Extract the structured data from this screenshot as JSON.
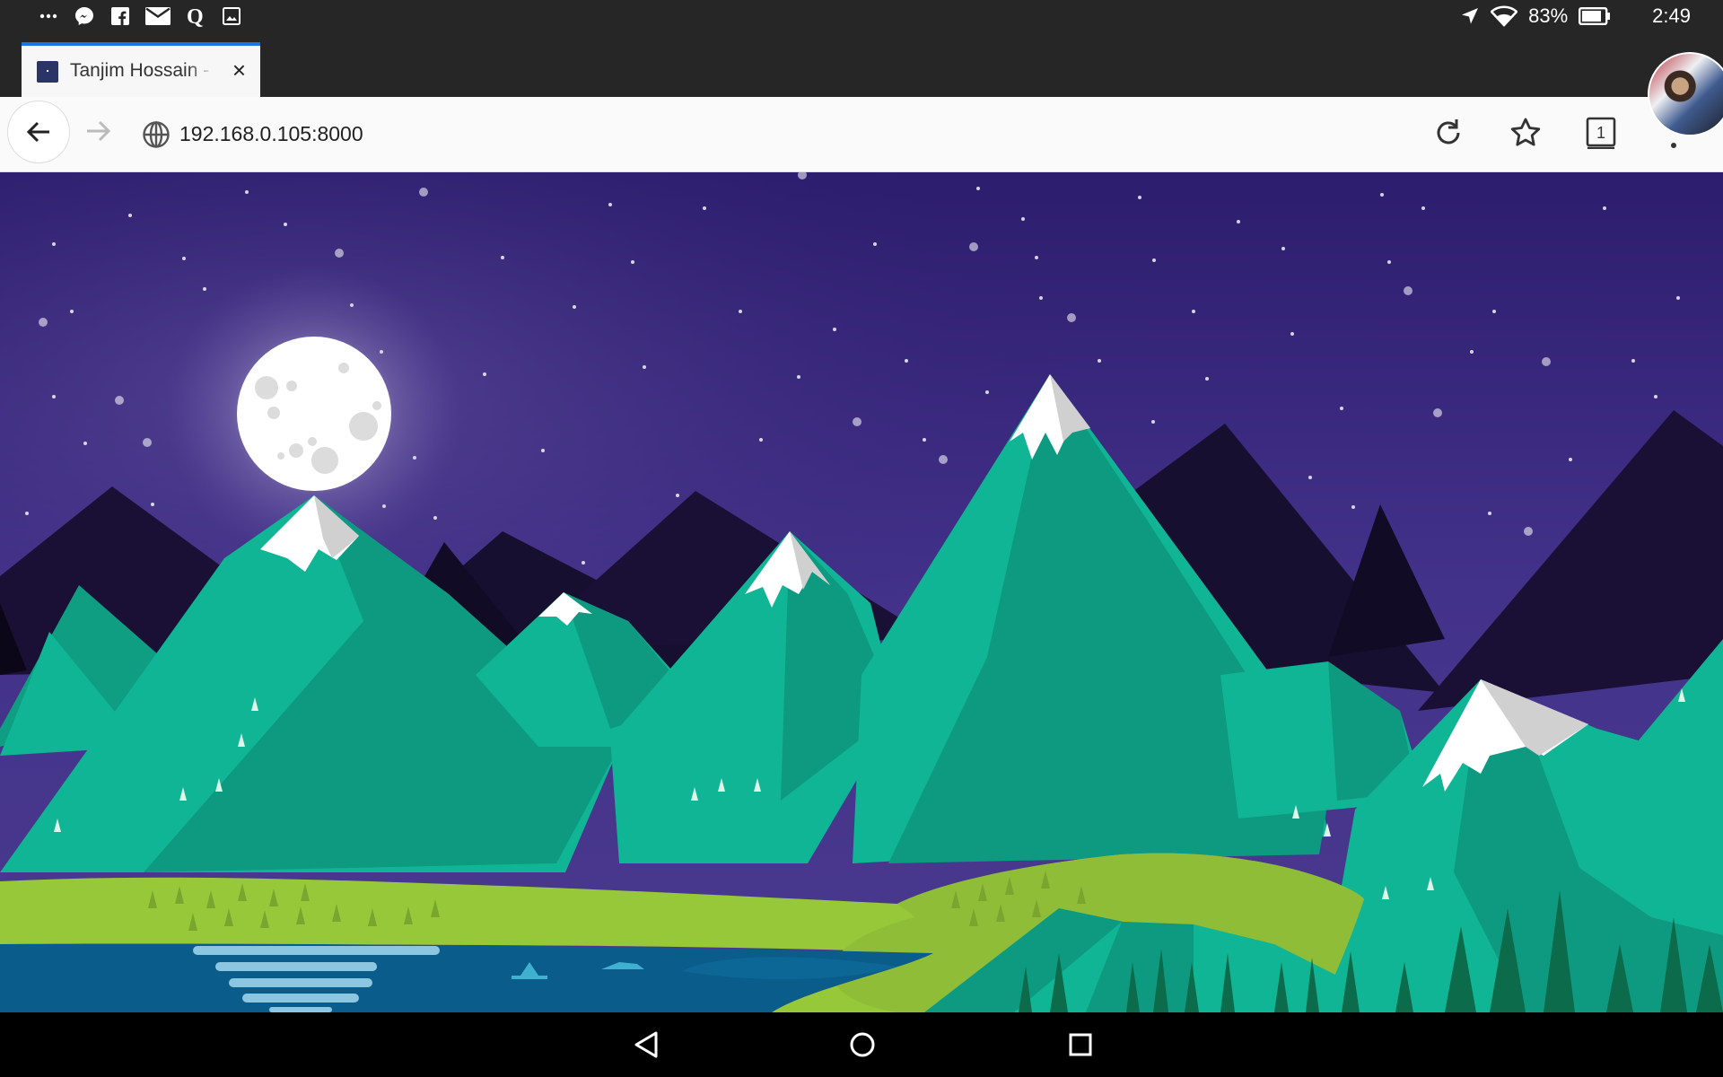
{
  "status_bar": {
    "icons": [
      "more-icon",
      "messenger-icon",
      "facebook-icon",
      "mail-icon",
      "quora-icon",
      "gallery-icon",
      "location-icon",
      "wifi-icon",
      "battery-icon"
    ],
    "battery": "83%",
    "time": "2:49"
  },
  "tab": {
    "title": "Tanjim Hossain -",
    "close": "×"
  },
  "address_bar": {
    "url": "192.168.0.105:8000"
  },
  "toolbar": {
    "tab_count": "1"
  },
  "colors": {
    "sky_top": "#2d1d6e",
    "sky_mid": "#4b3a8a",
    "mountain_teal": "#10b596",
    "mountain_dark_teal": "#0d9a80",
    "grass": "#96c83a",
    "lake": "#0a5c8a",
    "far_mountains": "#1a1036",
    "accent": "#1a73e8"
  },
  "nav_bar": {
    "icons": [
      "back-triangle-icon",
      "home-circle-icon",
      "recents-square-icon"
    ]
  }
}
